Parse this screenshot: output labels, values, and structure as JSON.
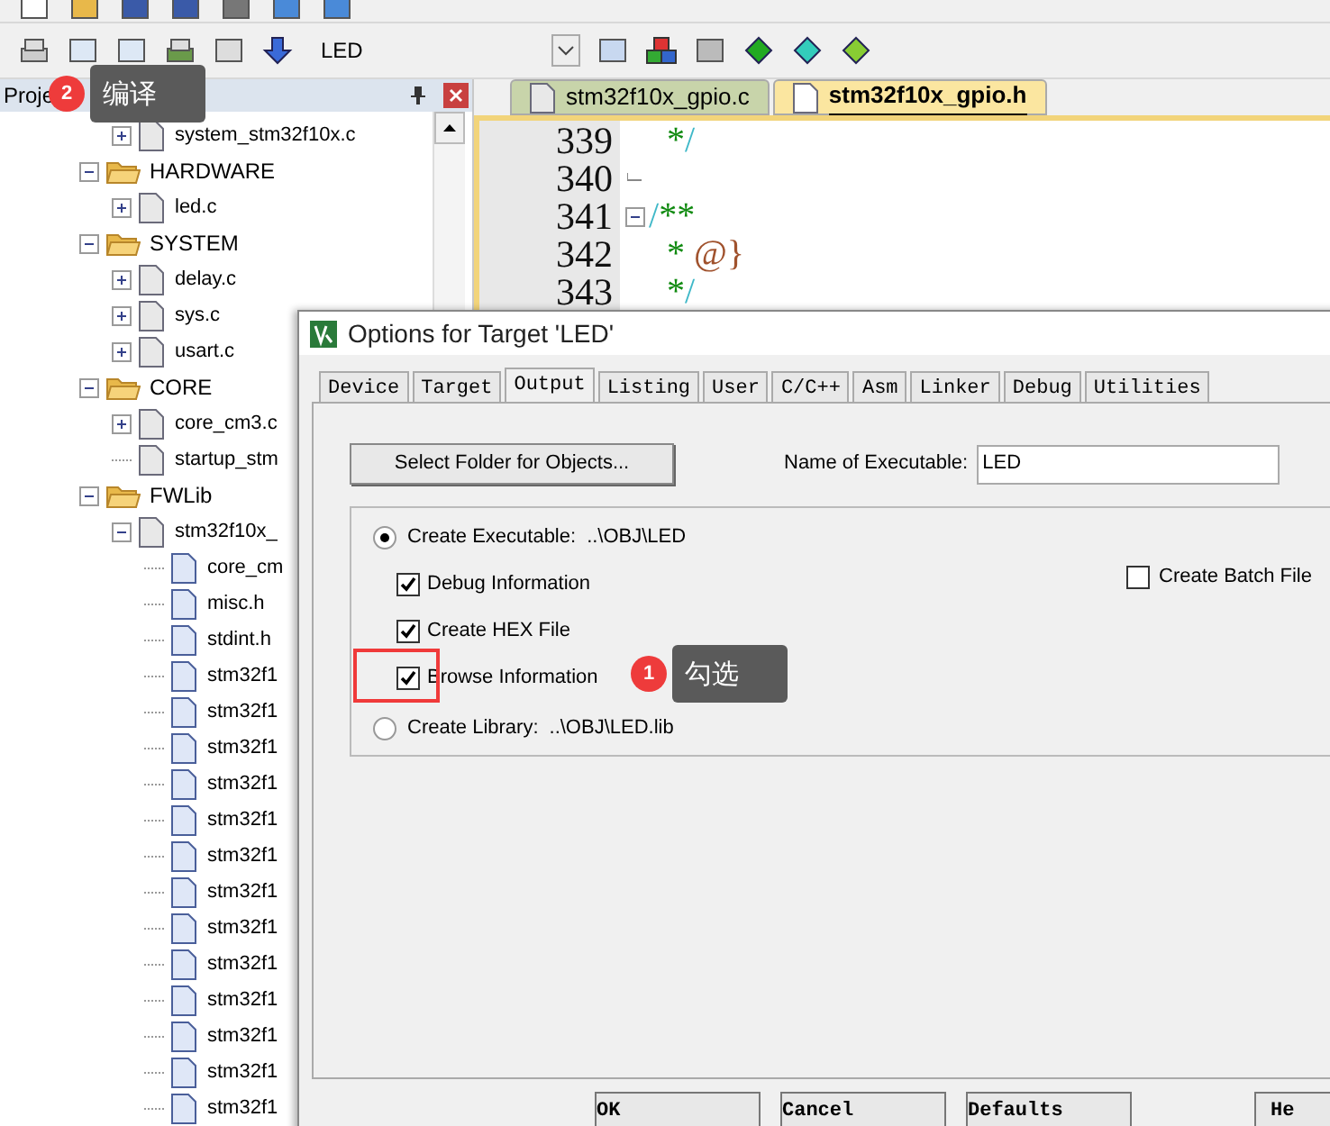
{
  "toolbar": {
    "target": "LED"
  },
  "project_panel": {
    "title": "Proje",
    "leading_files": [
      {
        "label": "system_stm32f10x.c",
        "kind": "source",
        "expanded": false
      }
    ],
    "groups": [
      {
        "label": "HARDWARE",
        "expanded": true,
        "files": [
          {
            "label": "led.c",
            "kind": "source",
            "expanded": false
          }
        ]
      },
      {
        "label": "SYSTEM",
        "expanded": true,
        "files": [
          {
            "label": "delay.c",
            "kind": "source",
            "expanded": false
          },
          {
            "label": "sys.c",
            "kind": "source",
            "expanded": false
          },
          {
            "label": "usart.c",
            "kind": "source",
            "expanded": false
          }
        ]
      },
      {
        "label": "CORE",
        "expanded": true,
        "files": [
          {
            "label": "core_cm3.c",
            "kind": "source",
            "expanded": false
          },
          {
            "label": "startup_stm",
            "kind": "source"
          }
        ]
      },
      {
        "label": "FWLib",
        "expanded": true,
        "files": [
          {
            "label": "stm32f10x_",
            "kind": "source",
            "expanded": true,
            "children": [
              {
                "label": "core_cm",
                "kind": "header"
              },
              {
                "label": "misc.h",
                "kind": "header"
              },
              {
                "label": "stdint.h",
                "kind": "header"
              },
              {
                "label": "stm32f1",
                "kind": "header"
              },
              {
                "label": "stm32f1",
                "kind": "header"
              },
              {
                "label": "stm32f1",
                "kind": "header"
              },
              {
                "label": "stm32f1",
                "kind": "header"
              },
              {
                "label": "stm32f1",
                "kind": "header"
              },
              {
                "label": "stm32f1",
                "kind": "header"
              },
              {
                "label": "stm32f1",
                "kind": "header"
              },
              {
                "label": "stm32f1",
                "kind": "header"
              },
              {
                "label": "stm32f1",
                "kind": "header"
              },
              {
                "label": "stm32f1",
                "kind": "header"
              },
              {
                "label": "stm32f1",
                "kind": "header"
              },
              {
                "label": "stm32f1",
                "kind": "header"
              },
              {
                "label": "stm32f1",
                "kind": "header"
              }
            ]
          }
        ]
      }
    ]
  },
  "editor": {
    "tabs": [
      {
        "label": "stm32f10x_gpio.c",
        "selected": false
      },
      {
        "label": "stm32f10x_gpio.h",
        "selected": true
      }
    ],
    "lines": [
      {
        "number": "339",
        "parts": [
          {
            "text": "  *",
            "kind": "star"
          },
          {
            "text": "/",
            "kind": "slash"
          }
        ]
      },
      {
        "number": "340",
        "kind": "fold_end"
      },
      {
        "number": "341",
        "kind": "fold_start",
        "parts": [
          {
            "text": "/",
            "kind": "slash"
          },
          {
            "text": "**",
            "kind": "star"
          }
        ]
      },
      {
        "number": "342",
        "parts": [
          {
            "text": "  * ",
            "kind": "star"
          },
          {
            "text": "@}",
            "kind": "tag"
          }
        ]
      },
      {
        "number": "343",
        "parts": [
          {
            "text": "  *",
            "kind": "star"
          },
          {
            "text": "/",
            "kind": "slash"
          }
        ]
      }
    ]
  },
  "dialog": {
    "title": "Options for Target 'LED'",
    "tabs": [
      {
        "label": "Device",
        "selected": false
      },
      {
        "label": "Target",
        "selected": false
      },
      {
        "label": "Output",
        "selected": true
      },
      {
        "label": "Listing",
        "selected": false
      },
      {
        "label": "User",
        "selected": false
      },
      {
        "label": "C/C++",
        "selected": false
      },
      {
        "label": "Asm",
        "selected": false
      },
      {
        "label": "Linker",
        "selected": false
      },
      {
        "label": "Debug",
        "selected": false
      },
      {
        "label": "Utilities",
        "selected": false
      }
    ],
    "select_folder_button": "Select Folder for Objects...",
    "name_of_executable": {
      "label": "Name of Executable:",
      "value": "LED"
    },
    "create_executable": {
      "label": "Create Executable:",
      "path": "..\\OBJ\\LED",
      "selected": true
    },
    "options": [
      {
        "label": "Debug Information",
        "checked": true
      },
      {
        "label": "Create HEX File",
        "checked": true
      },
      {
        "label": "Browse Information",
        "checked": true
      }
    ],
    "create_batch_file": {
      "label": "Create Batch File",
      "checked": false
    },
    "create_library": {
      "label": "Create Library:",
      "path": "..\\OBJ\\LED.lib",
      "selected": false
    },
    "buttons": [
      "OK",
      "Cancel",
      "Defaults",
      "He"
    ]
  },
  "annotations": [
    {
      "number": "2",
      "text": "编译"
    },
    {
      "number": "1",
      "text": "勾选"
    }
  ]
}
